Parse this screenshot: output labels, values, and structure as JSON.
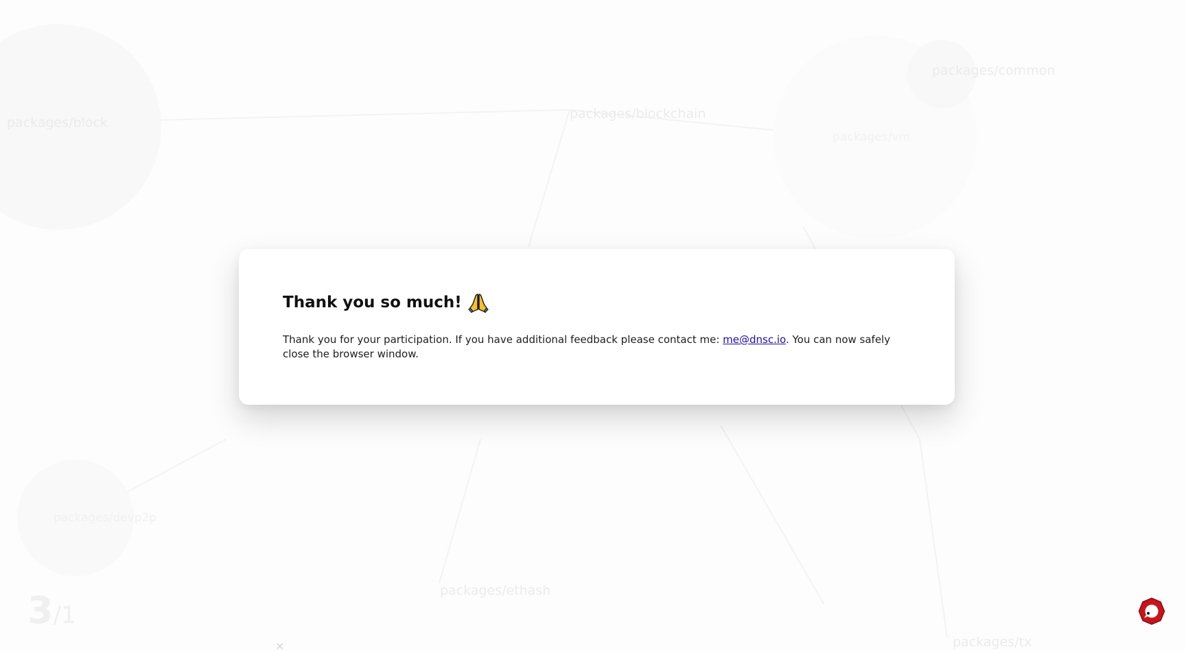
{
  "background_graph": {
    "nodes": [
      {
        "label": "packages/block"
      },
      {
        "label": "packages/blockchain"
      },
      {
        "label": "packages/common"
      },
      {
        "label": "packages/vm"
      },
      {
        "label": "packages/devp2p"
      },
      {
        "label": "packages/ethash"
      },
      {
        "label": "packages/tx"
      }
    ],
    "counter": {
      "current": "3",
      "total": "/1"
    }
  },
  "modal": {
    "title": "Thank you so much!",
    "title_icon": "folded-hands-emoji",
    "body_before_link": "Thank you for your participation. If you have additional feedback please contact me: ",
    "email_link": "me@dnsc.io",
    "body_after_link": ". You can now safely close the browser window."
  },
  "widget": {
    "icon": "help-bubble-icon",
    "color": "#c8141c"
  }
}
